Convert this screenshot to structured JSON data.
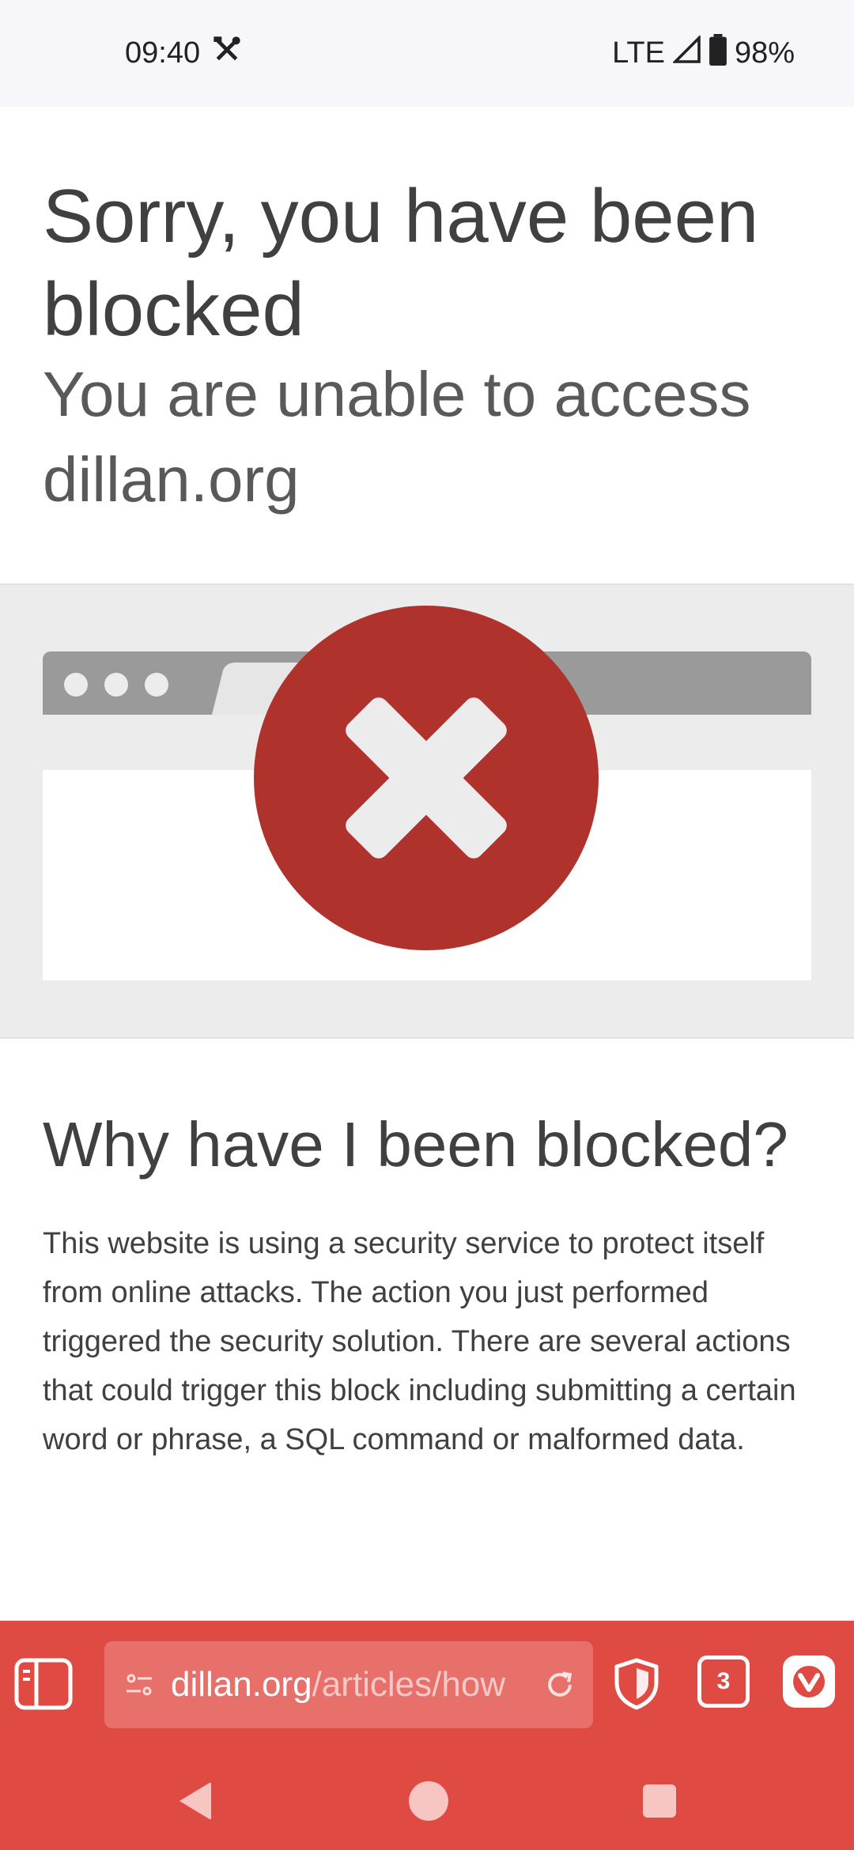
{
  "status_bar": {
    "time": "09:40",
    "network": "LTE",
    "battery": "98%",
    "icons": [
      "tools-icon",
      "signal-icon",
      "battery-icon"
    ]
  },
  "hero": {
    "title": "Sorry, you have been blocked",
    "subtitle": "You are unable to access dillan.org"
  },
  "why": {
    "heading": "Why have I been blocked?",
    "body": "This website is using a security service to protect itself from online attacks. The action you just performed triggered the security solution. There are several actions that could trigger this block including submitting a certain word or phrase, a SQL command or malformed data."
  },
  "browser_toolbar": {
    "url_domain": "dillan.org",
    "url_path": "/articles/how",
    "tab_count": "3"
  },
  "colors": {
    "toolbar": "#df4b43",
    "blocked_circle": "#b0322c"
  }
}
